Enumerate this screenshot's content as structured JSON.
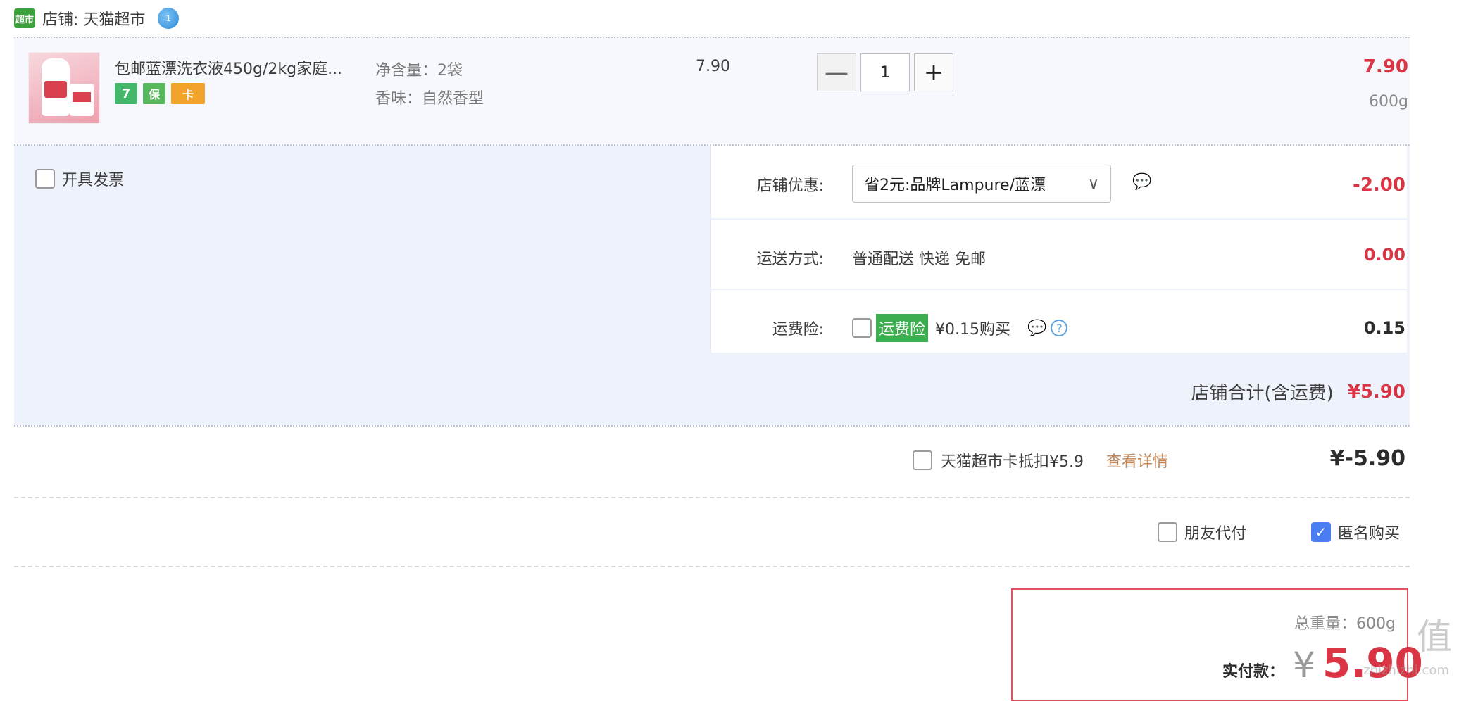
{
  "shop": {
    "badge": "超市",
    "name": "店铺: 天猫超市",
    "ww_badge": "1"
  },
  "item": {
    "title": "包邮蓝漂洗衣液450g/2kg家庭...",
    "services": [
      "7",
      "保",
      "卡"
    ],
    "spec_weight": "净含量：2袋",
    "spec_scent": "香味：自然香型",
    "unit_price": "7.90",
    "quantity": "1",
    "minus": "—",
    "plus": "+",
    "total": "7.90",
    "weight": "600g"
  },
  "options": {
    "invoice_label": "开具发票",
    "coupon": {
      "label": "店铺优惠:",
      "selected": "省2元:品牌Lampure/蓝漂",
      "amount": "-2.00"
    },
    "shipping": {
      "label": "运送方式:",
      "value": "普通配送 快递 免邮",
      "amount": "0.00"
    },
    "insurance": {
      "label": "运费险:",
      "tag": "运费险",
      "value": "¥0.15购买",
      "amount": "0.15",
      "help": "?"
    }
  },
  "shop_total": {
    "label": "店铺合计(含运费)",
    "value": "¥5.90"
  },
  "card": {
    "label": "天猫超市卡抵扣¥5.9",
    "link": "查看详情",
    "amount": "¥-5.90"
  },
  "extras": {
    "friend_pay": "朋友代付",
    "anonymous": "匿名购买"
  },
  "summary": {
    "total_weight": "总重量：600g",
    "pay_label": "实付款：",
    "currency": "¥",
    "pay_value": "5.90"
  },
  "watermark": {
    "text": "值",
    "site": "zhizhizhi.com"
  },
  "colors": {
    "accent_red": "#d93545",
    "check_blue": "#4a7df1",
    "insurance_green": "#3cae4f",
    "link_brown": "#c0875a"
  }
}
